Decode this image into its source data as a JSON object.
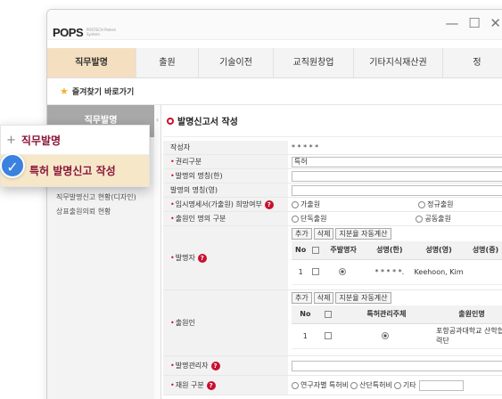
{
  "window": {
    "controls": "— ☐ ✕"
  },
  "logo": {
    "text": "POPS",
    "sub": "POSTECH Patent System"
  },
  "menu": [
    "직무발명",
    "출원",
    "기술이전",
    "교직원창업",
    "기타지식재산권",
    "정"
  ],
  "favorites": {
    "label": "즐겨찾기 바로가기"
  },
  "sidebar": {
    "title": "직무발명",
    "items": [
      "직무발명신고 현황(디자인)",
      "상표출원의뢰 현황"
    ]
  },
  "callout": {
    "item1": "직무발명",
    "item2": "특허 발명신고 작성"
  },
  "page": {
    "title": "발명신고서 작성"
  },
  "form": {
    "writer_label": "작성자",
    "writer_value": "* * * * *",
    "right_type_label": "권리구분",
    "right_type_value": "특허",
    "name_ko_label": "발명의 명칭(한)",
    "name_en_label": "발명의 명칭(영)",
    "temp_spec_label": "임시명세서(가출원) 희망여부",
    "temp_opt1": "가출원",
    "temp_opt2": "정규출원",
    "applicant_label": "출원인 명의 구분",
    "app_opt1": "단독출원",
    "app_opt2": "공동출원",
    "inventor_label": "발명자",
    "buttons": [
      "추가",
      "삭제",
      "지분율 자동계산"
    ],
    "inventor_headers": [
      "No",
      "",
      "주발명자",
      "성명(한)",
      "성명(영)",
      "성명(중)"
    ],
    "inventor_row": [
      "1",
      "",
      "",
      "* * * * *.",
      "Keehoon, Kim",
      ""
    ],
    "applicant2_label": "출원인",
    "applicant_headers": [
      "No",
      "",
      "특허관리주체",
      "출원인명"
    ],
    "applicant_row": [
      "1",
      "",
      "",
      "포항공과대학교 산학협력단"
    ],
    "manager_label": "발명관리자",
    "funding_label": "재원 구분",
    "funding_opts": [
      "연구자별 특허비",
      "산단특허비",
      "기타"
    ]
  }
}
